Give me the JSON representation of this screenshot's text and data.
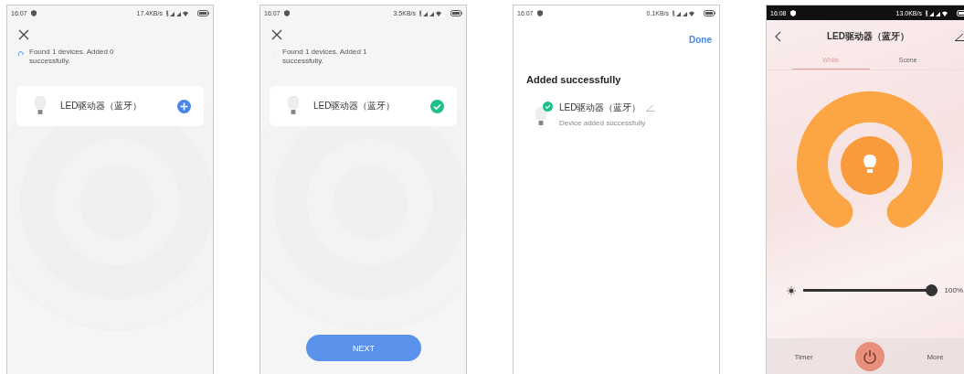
{
  "screens": [
    {
      "kind": "scan",
      "status": {
        "time": "16:07",
        "speed": "17.4KB/s",
        "dark": false
      },
      "loading": true,
      "message": "Found 1 devices. Added 0 successfully.",
      "device": {
        "name": "LED驱动器（蓝牙）",
        "added": false
      }
    },
    {
      "kind": "scan",
      "status": {
        "time": "16:07",
        "speed": "3.5KB/s",
        "dark": false
      },
      "loading": false,
      "message": "Found 1 devices. Added 1 successfully.",
      "device": {
        "name": "LED驱动器（蓝牙）",
        "added": true
      },
      "button": "NEXT"
    },
    {
      "kind": "result",
      "status": {
        "time": "16:07",
        "speed": "0.1KB/s",
        "dark": false
      },
      "action": "Done",
      "heading": "Added successfully",
      "device": {
        "name": "LED驱动器（蓝牙）",
        "note": "Device added successfully"
      }
    },
    {
      "kind": "control",
      "status": {
        "time": "16:08",
        "speed": "13.0KB/s",
        "dark": true
      },
      "title": "LED驱动器（蓝牙）",
      "tabs": [
        {
          "label": "White",
          "selected": true
        },
        {
          "label": "Scene",
          "selected": false
        }
      ],
      "brightness": {
        "level": 1,
        "reading": "100%"
      },
      "bottom": {
        "left": "Timer",
        "right": "More"
      }
    }
  ]
}
